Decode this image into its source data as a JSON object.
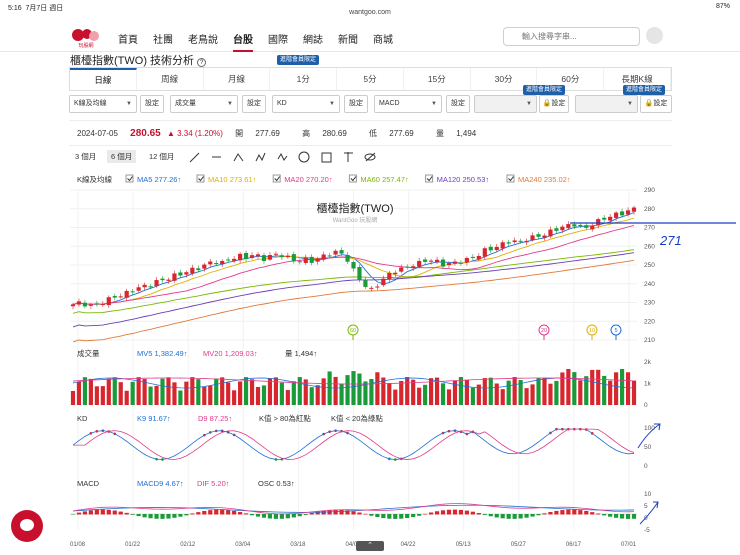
{
  "statusbar": {
    "time": "5:16",
    "date": "7月7日 週日",
    "url": "wantgoo.com",
    "battery": "87%"
  },
  "nav": {
    "items": [
      "首頁",
      "社團",
      "老鳥說",
      "台股",
      "國際",
      "網誌",
      "新聞",
      "商城"
    ],
    "active_index": 3,
    "logo_text": "玩股網",
    "search_placeholder": "輸入搜尋字串..."
  },
  "page_title": "櫃檯指數(TWO) 技術分析",
  "tabs": [
    "日線",
    "周線",
    "月線",
    "1分",
    "5分",
    "15分",
    "30分",
    "60分",
    "長期K線"
  ],
  "member_badge": "進階會員限定",
  "selectors": {
    "items": [
      "K線及均線",
      "成交量",
      "KD",
      "MACD"
    ],
    "setting_label": "設定"
  },
  "quote": {
    "date": "2024-07-05",
    "close": "280.65",
    "change": "▲ 3.34 (1.20%)",
    "open_label": "開",
    "open": "277.69",
    "high_label": "高",
    "high": "280.69",
    "low_label": "低",
    "low": "277.69",
    "vol_label": "量",
    "volume": "1,494"
  },
  "ranges": [
    "3 個月",
    "6 個月",
    "12 個月"
  ],
  "ma_legend": {
    "label": "K線及均線",
    "items": [
      {
        "name": "MA5",
        "value": "277.26↑",
        "color": "#1e6fd6"
      },
      {
        "name": "MA10",
        "value": "273.61↑",
        "color": "#e0b000"
      },
      {
        "name": "MA20",
        "value": "270.20↑",
        "color": "#e03a8c"
      },
      {
        "name": "MA60",
        "value": "257.47↑",
        "color": "#7ab800"
      },
      {
        "name": "MA120",
        "value": "250.53↑",
        "color": "#6a3fb8"
      },
      {
        "name": "MA240",
        "value": "235.02↑",
        "color": "#e07a3a"
      }
    ]
  },
  "main_chart": {
    "title": "櫃檯指數(TWO)",
    "watermark": "WantGoo 玩股網",
    "y_ticks": [
      "290",
      "280",
      "270",
      "260",
      "250",
      "240",
      "230",
      "220",
      "210"
    ],
    "markers": [
      "60",
      "20",
      "10",
      "5"
    ],
    "annotation": "271"
  },
  "volume": {
    "label": "成交量",
    "mv5": "MV5 1,382.49↑",
    "mv20": "MV20 1,209.03↑",
    "vol": "量 1,494↑",
    "y_ticks": [
      "2k",
      "1k",
      "0"
    ]
  },
  "kd": {
    "label": "KD",
    "k": "K9 91.67↑",
    "d": "D9 87.25↑",
    "note1": "K值 > 80為紅點",
    "note2": "K值 < 20為綠點",
    "y_ticks": [
      "100",
      "50",
      "0"
    ]
  },
  "macd": {
    "label": "MACD",
    "macd": "MACD9 4.67↑",
    "dif": "DIF 5.20↑",
    "osc": "OSC 0.53↑",
    "y_ticks": [
      "10",
      "5",
      "0",
      "-5"
    ]
  },
  "x_ticks": [
    "01/08",
    "01/22",
    "02/12",
    "03/04",
    "03/18",
    "04/08",
    "04/22",
    "05/13",
    "05/27",
    "06/17",
    "07/01"
  ],
  "chart_data": {
    "type": "candlestick",
    "title": "櫃檯指數(TWO)",
    "ylim": [
      210,
      290
    ],
    "close_path": [
      229,
      230,
      228,
      229,
      231,
      233,
      234,
      236,
      238,
      239,
      241,
      242,
      244,
      245,
      247,
      248,
      250,
      252,
      251,
      253,
      255,
      254,
      256,
      253,
      255,
      256,
      254,
      252,
      253,
      252,
      254,
      256,
      257,
      255,
      247,
      241,
      236,
      240,
      244,
      247,
      248,
      250,
      251,
      253,
      252,
      250,
      251,
      252,
      253,
      255,
      258,
      259,
      261,
      263,
      262,
      264,
      265,
      266,
      268,
      270,
      271,
      272,
      269,
      272,
      274,
      276,
      277,
      278,
      281
    ]
  }
}
